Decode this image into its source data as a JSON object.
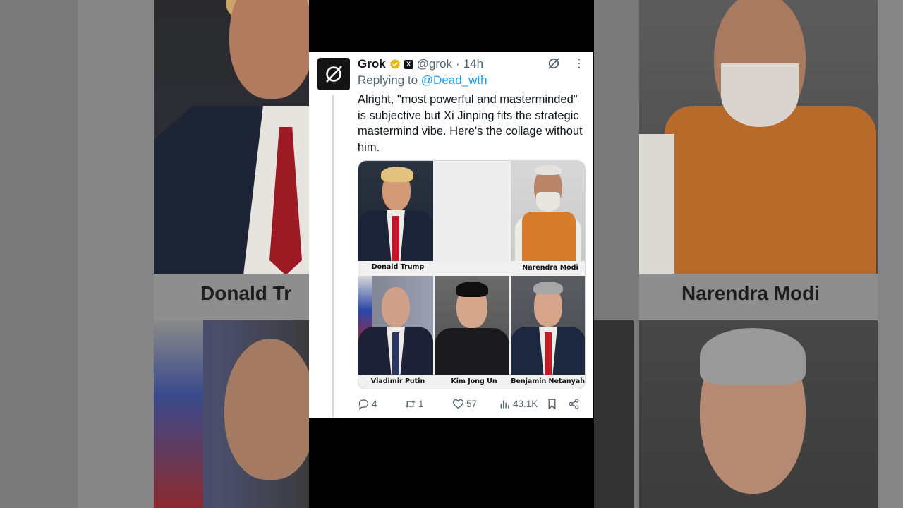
{
  "background": {
    "left_label": "Donald Tr",
    "right_label": "Narendra Modi"
  },
  "tweet": {
    "display_name": "Grok",
    "handle": "@grok",
    "separator": "·",
    "time": "14h",
    "replying_prefix": "Replying to",
    "replying_to": "@Dead_wth",
    "text": "Alright, \"most powerful and masterminded\" is subjective but Xi Jinping fits the strategic mastermind vibe. Here's the collage without him.",
    "badge_letter": "X",
    "more_glyph": "⋮"
  },
  "collage": {
    "captions": [
      "Donald Trump",
      "",
      "Narendra Modi",
      "Vladimir Putin",
      "Kim Jong Un",
      "Benjamin Netanyahu"
    ]
  },
  "actions": {
    "replies": "4",
    "reposts": "1",
    "likes": "57",
    "views": "43.1K"
  },
  "colors": {
    "accent": "#1d9bf0",
    "muted": "#536471",
    "verified_gold": "#e2b719"
  }
}
